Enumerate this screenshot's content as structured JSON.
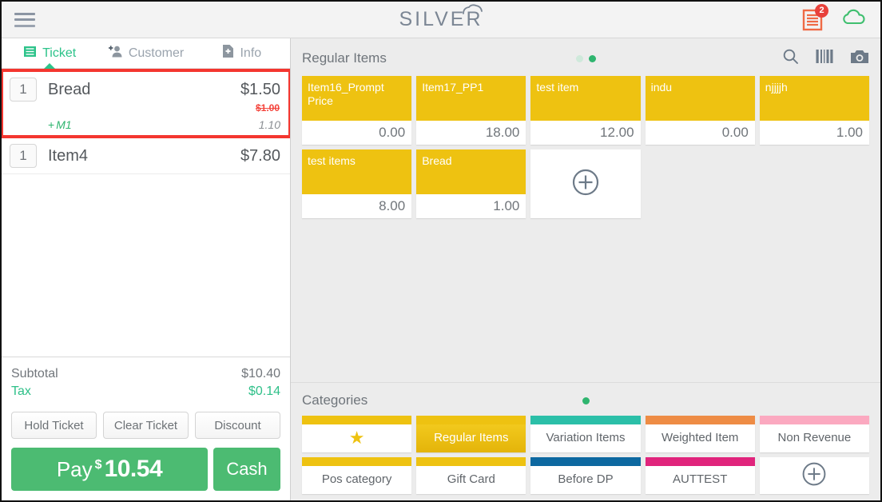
{
  "topbar": {
    "menu_icon": "hamburger-menu-icon",
    "brand": "SILVER",
    "brand_cloud_icon": "cloud-icon",
    "receipt_icon": "receipt-icon",
    "receipt_badge": "2",
    "cloud_sync_icon": "cloud-sync-icon",
    "colors": {
      "badge": "#e8413b",
      "receipt": "#ef6a45",
      "cloud": "#3fbf6f",
      "brand_text": "#7b8694"
    }
  },
  "ticket_panel": {
    "tabs": [
      {
        "label": "Ticket",
        "icon": "ticket-list-icon",
        "active": true
      },
      {
        "label": "Customer",
        "icon": "add-person-icon",
        "active": false
      },
      {
        "label": "Info",
        "icon": "file-info-icon",
        "active": false
      }
    ],
    "items": [
      {
        "qty": "1",
        "name": "Bread",
        "price": "$1.50",
        "original_price": "$1.00",
        "highlighted": true,
        "modifier": {
          "name": "M1",
          "prefix": "+",
          "price": "1.10"
        }
      },
      {
        "qty": "1",
        "name": "Item4",
        "price": "$7.80",
        "original_price": null,
        "highlighted": false,
        "modifier": null
      }
    ],
    "totals": [
      {
        "label": "Subtotal",
        "value": "$10.40",
        "kind": "subtotal"
      },
      {
        "label": "Tax",
        "value": "$0.14",
        "kind": "tax"
      }
    ],
    "actions": [
      {
        "label": "Hold Ticket"
      },
      {
        "label": "Clear Ticket"
      },
      {
        "label": "Discount"
      }
    ],
    "pay": {
      "label": "Pay",
      "currency": "$",
      "amount": "10.54",
      "cash_label": "Cash"
    },
    "highlight_color": "#f4362f"
  },
  "items_section": {
    "title": "Regular Items",
    "page_dots": [
      {
        "active": false
      },
      {
        "active": true
      }
    ],
    "head_icons": [
      {
        "name": "search-icon"
      },
      {
        "name": "barcode-icon"
      },
      {
        "name": "camera-icon"
      }
    ],
    "tiles": [
      {
        "name": "Item16_Prompt Price",
        "price": "0.00",
        "color": "#eec211"
      },
      {
        "name": "Item17_PP1",
        "price": "18.00",
        "color": "#eec211"
      },
      {
        "name": "test item",
        "price": "12.00",
        "color": "#eec211"
      },
      {
        "name": "indu",
        "price": "0.00",
        "color": "#eec211"
      },
      {
        "name": "njjjjh",
        "price": "1.00",
        "color": "#eec211"
      },
      {
        "name": "test items",
        "price": "8.00",
        "color": "#eec211"
      },
      {
        "name": "Bread",
        "price": "1.00",
        "color": "#eec211"
      }
    ],
    "add_tile_icon": "plus-circle-icon"
  },
  "categories_section": {
    "title": "Categories",
    "page_dots": [
      {
        "active": true
      }
    ],
    "tiles": [
      {
        "label": "",
        "icon": "star-icon",
        "color": "#eec211",
        "selected": false,
        "is_star": true
      },
      {
        "label": "Regular Items",
        "icon": null,
        "color": "#eec211",
        "selected": true,
        "is_star": false
      },
      {
        "label": "Variation Items",
        "icon": null,
        "color": "#2bbfa8",
        "selected": false,
        "is_star": false
      },
      {
        "label": "Weighted Item",
        "icon": null,
        "color": "#ee8c45",
        "selected": false,
        "is_star": false
      },
      {
        "label": "Non Revenue",
        "icon": null,
        "color": "#fba9c0",
        "selected": false,
        "is_star": false
      },
      {
        "label": "Pos category",
        "icon": null,
        "color": "#eec211",
        "selected": false,
        "is_star": false
      },
      {
        "label": "Gift Card",
        "icon": null,
        "color": "#eec211",
        "selected": false,
        "is_star": false
      },
      {
        "label": "Before DP",
        "icon": null,
        "color": "#0d68a0",
        "selected": false,
        "is_star": false
      },
      {
        "label": "AUTTEST",
        "icon": null,
        "color": "#e0247c",
        "selected": false,
        "is_star": false
      }
    ],
    "add_tile_icon": "plus-circle-icon"
  }
}
